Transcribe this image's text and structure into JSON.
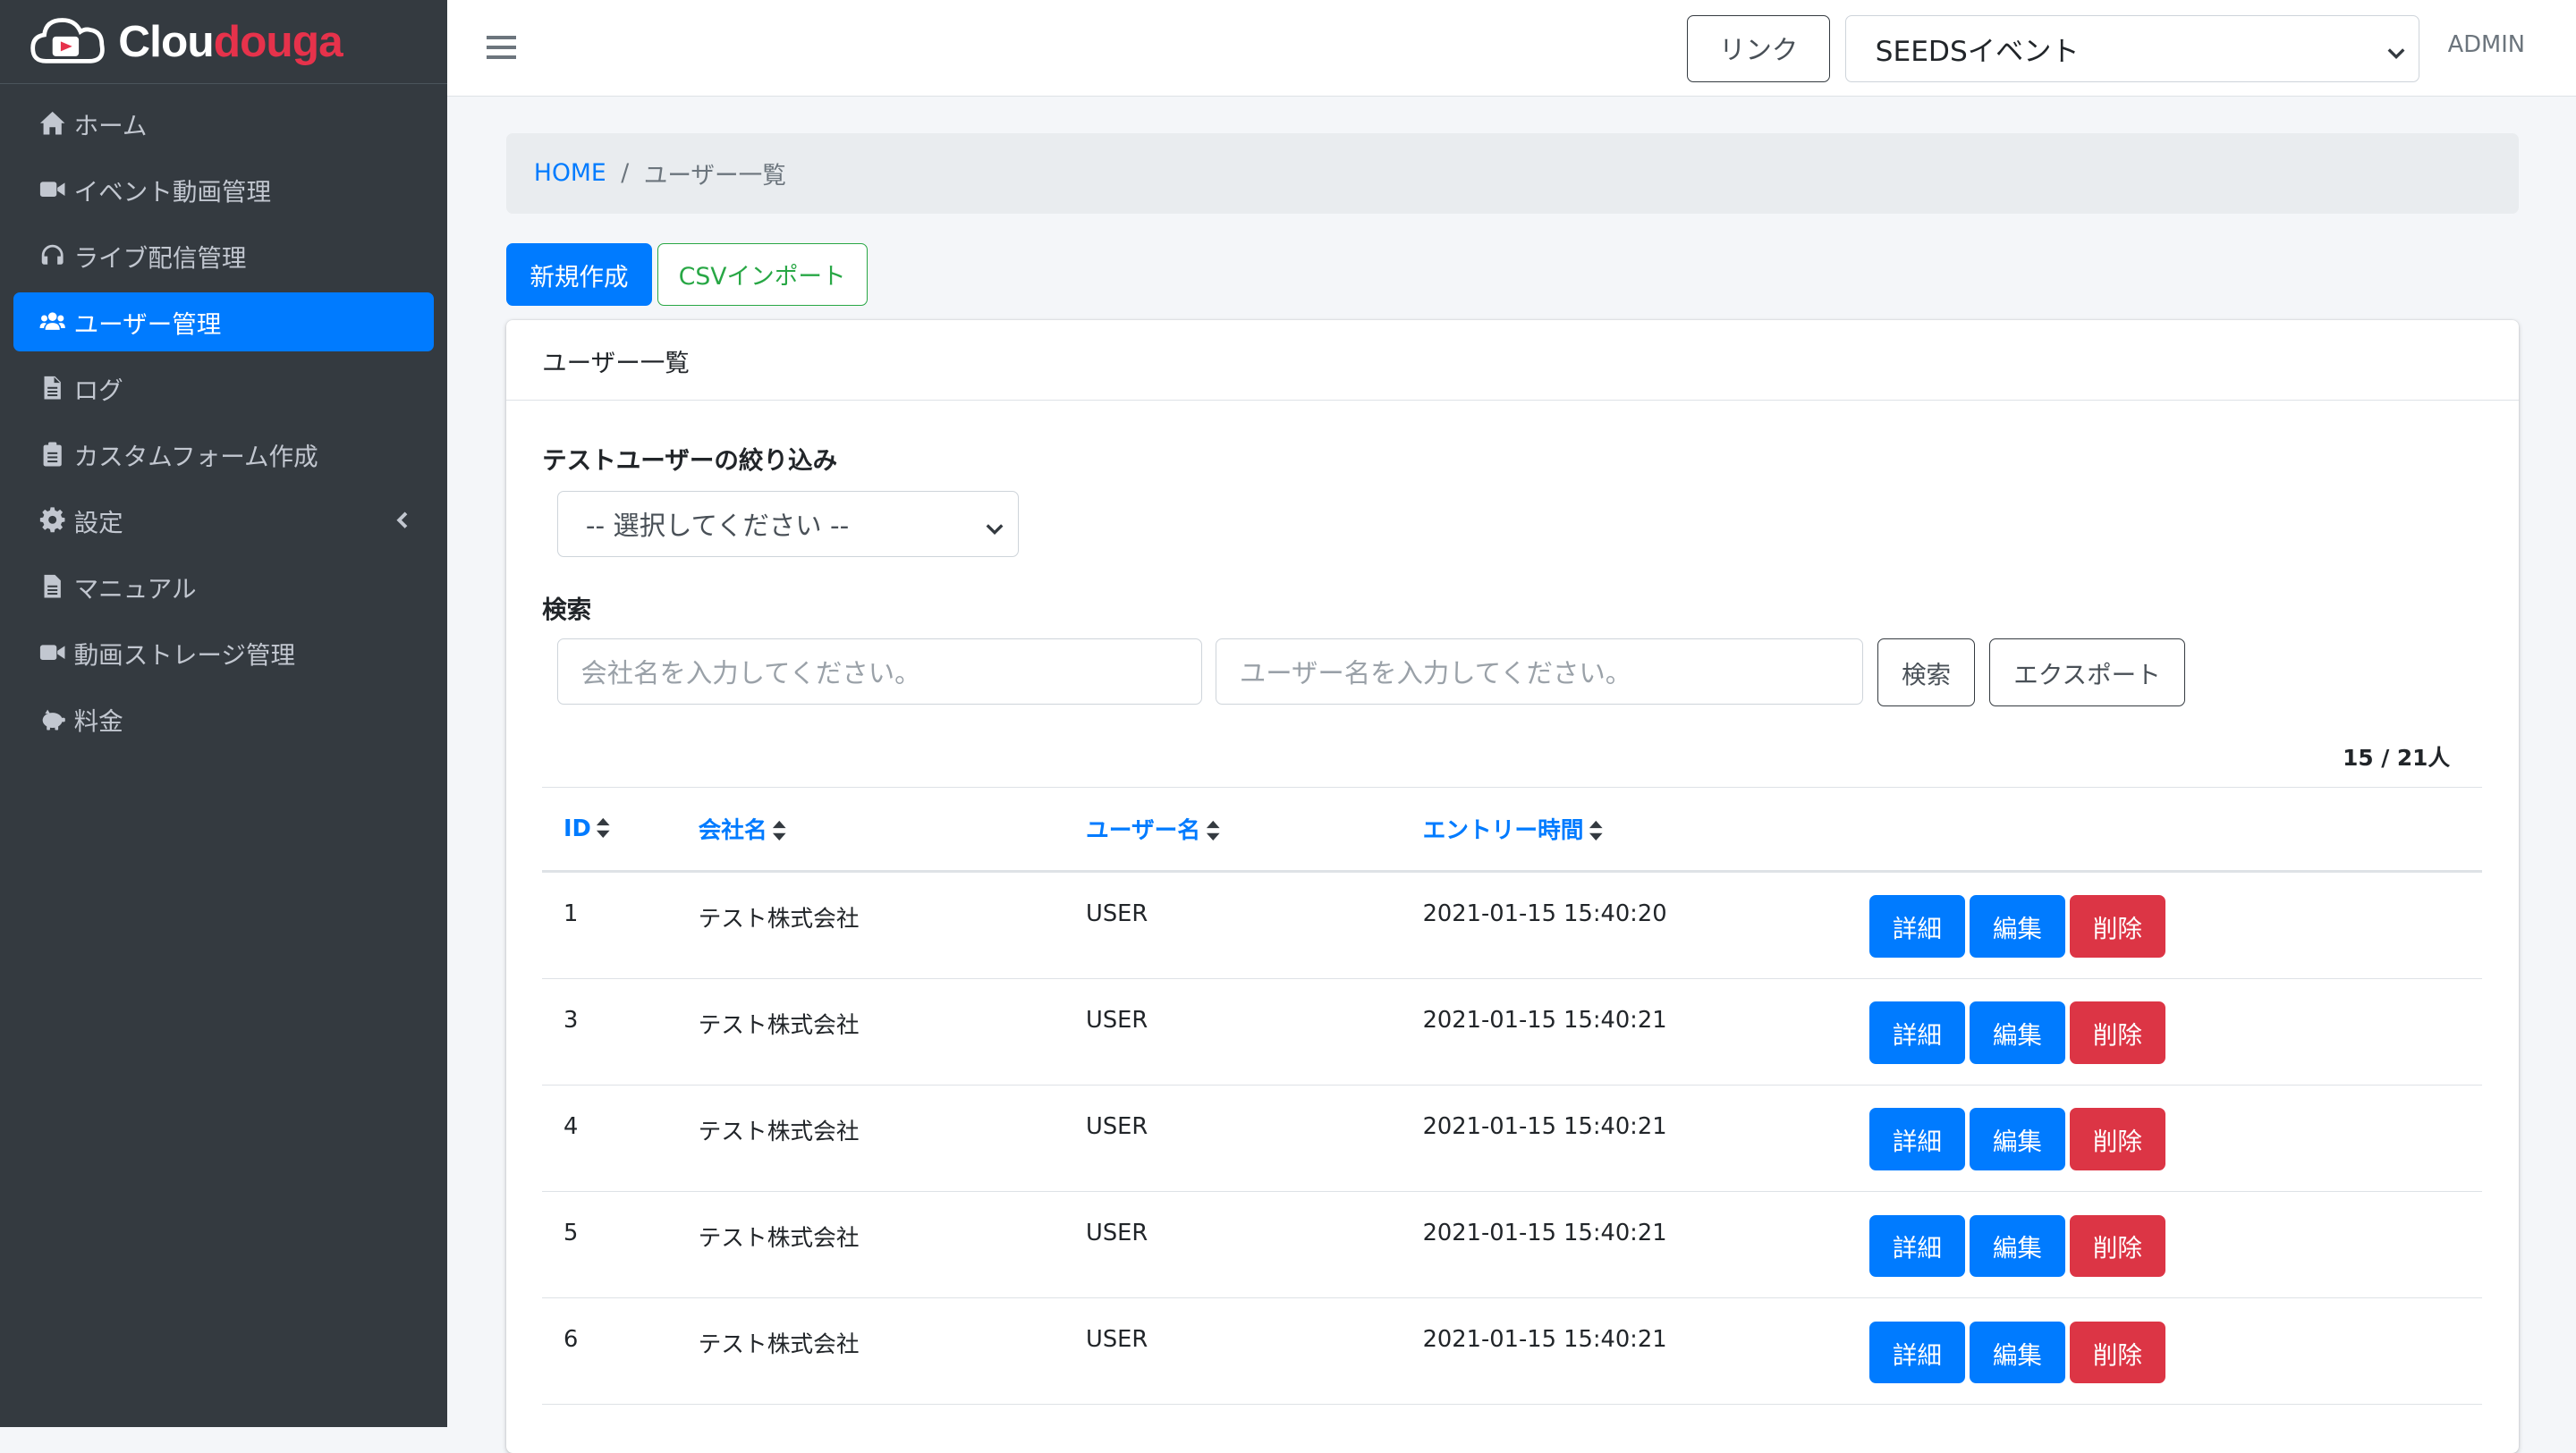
{
  "brand": {
    "name_part1": "Clou",
    "name_part2": "douga"
  },
  "sidebar": {
    "items": [
      {
        "icon": "home-icon",
        "label": "ホーム"
      },
      {
        "icon": "video-icon",
        "label": "イベント動画管理"
      },
      {
        "icon": "headset-icon",
        "label": "ライブ配信管理"
      },
      {
        "icon": "users-icon",
        "label": "ユーザー管理",
        "active": true
      },
      {
        "icon": "file-icon",
        "label": "ログ"
      },
      {
        "icon": "clipboard-icon",
        "label": "カスタムフォーム作成"
      },
      {
        "icon": "gear-icon",
        "label": "設定",
        "has_arrow": true
      },
      {
        "icon": "file-icon",
        "label": "マニュアル"
      },
      {
        "icon": "video-icon",
        "label": "動画ストレージ管理"
      },
      {
        "icon": "piggy-bank-icon",
        "label": "料金"
      }
    ]
  },
  "header": {
    "link_label": "リンク",
    "event_select_value": "SEEDSイベント",
    "user_label": "ADMIN"
  },
  "breadcrumb": {
    "home": "HOME",
    "separator": "/",
    "current": "ユーザー一覧"
  },
  "toolbar": {
    "new_label": "新規作成",
    "csv_label": "CSVインポート"
  },
  "card": {
    "title": "ユーザー一覧",
    "filter_label": "テストユーザーの絞り込み",
    "filter_value": "-- 選択してください --",
    "search_label": "検索",
    "company_placeholder": "会社名を入力してください。",
    "user_placeholder": "ユーザー名を入力してください。",
    "search_button": "検索",
    "export_button": "エクスポート",
    "count": "15 / 21人"
  },
  "table": {
    "headers": [
      "ID",
      "会社名",
      "ユーザー名",
      "エントリー時間"
    ],
    "rows": [
      {
        "id": "1",
        "company": "テスト株式会社",
        "user": "USER",
        "time": "2021-01-15 15:40:20"
      },
      {
        "id": "3",
        "company": "テスト株式会社",
        "user": "USER",
        "time": "2021-01-15 15:40:21"
      },
      {
        "id": "4",
        "company": "テスト株式会社",
        "user": "USER",
        "time": "2021-01-15 15:40:21"
      },
      {
        "id": "5",
        "company": "テスト株式会社",
        "user": "USER",
        "time": "2021-01-15 15:40:21"
      },
      {
        "id": "6",
        "company": "テスト株式会社",
        "user": "USER",
        "time": "2021-01-15 15:40:21"
      }
    ],
    "actions": {
      "detail": "詳細",
      "edit": "編集",
      "delete": "削除"
    }
  },
  "colors": {
    "primary": "#007bff",
    "danger": "#dc3545",
    "success": "#28a745",
    "sidebar": "#343a40",
    "brand_accent": "#e6324b"
  }
}
